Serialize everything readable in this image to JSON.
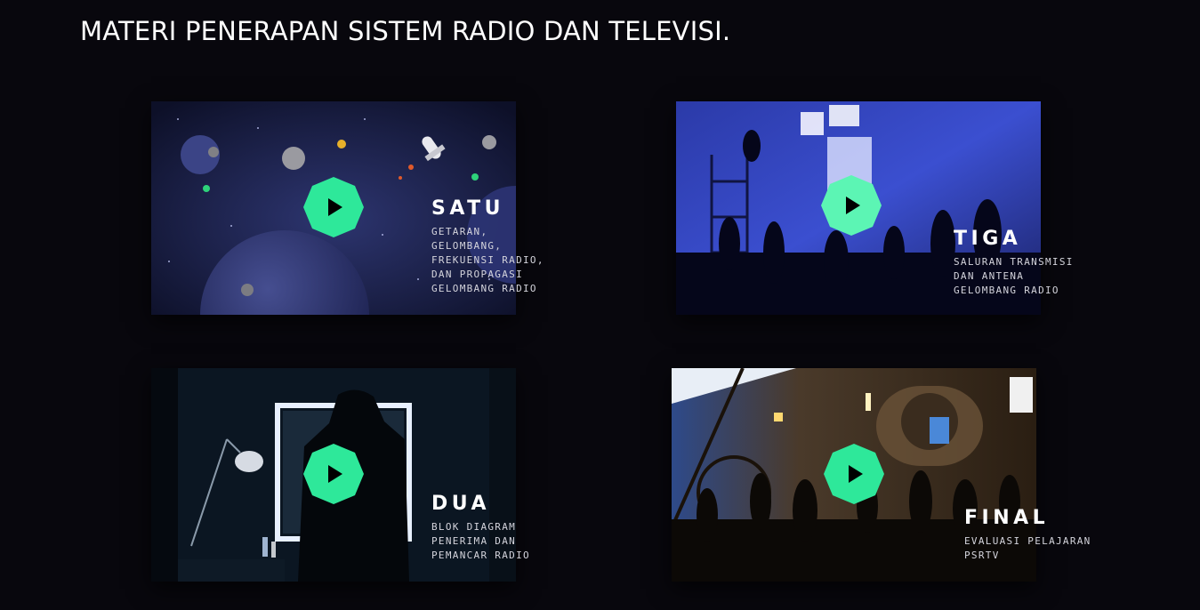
{
  "page": {
    "title": "MATERI PENERAPAN SISTEM RADIO DAN TELEVISI."
  },
  "colors": {
    "background": "#08070d",
    "play_button": "#2ee89a",
    "play_icon": "#000000",
    "text": "#ffffff",
    "subtext": "#d4d4dc"
  },
  "cards": [
    {
      "id": "satu",
      "title": "SATU",
      "description": "GETARAN,\nGELOMBANG,\nFREKUENSI RADIO,\nDAN PROPAGASI\nGELOMBANG RADIO",
      "thumbnail": "space-scene",
      "play_icon": "play-icon"
    },
    {
      "id": "tiga",
      "title": "TIGA",
      "description": "SALURAN TRANSMISI\nDAN ANTENA\nGELOMBANG RADIO",
      "thumbnail": "film-studio-blue",
      "play_icon": "play-icon"
    },
    {
      "id": "dua",
      "title": "DUA",
      "description": "BLOK DIAGRAM\nPENERIMA DAN\nPEMANCAR RADIO",
      "thumbnail": "mirror-room",
      "play_icon": "play-icon"
    },
    {
      "id": "final",
      "title": "FINAL",
      "description": "EVALUASI PELAJARAN\nPSRTV",
      "thumbnail": "film-set",
      "play_icon": "play-icon"
    }
  ]
}
